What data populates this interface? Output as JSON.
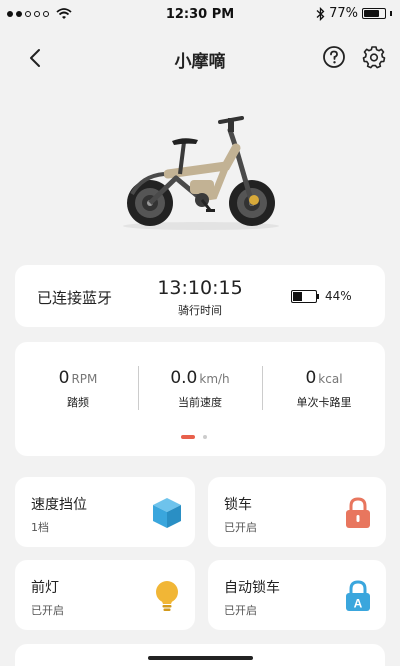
{
  "status_bar": {
    "signal_dots_filled": 2,
    "signal_dots_total": 5,
    "wifi_icon": "wifi-icon",
    "time": "12:30 PM",
    "bluetooth_icon": "bluetooth-icon",
    "battery_percent": "77%",
    "battery_level": 0.77
  },
  "nav": {
    "title": "小摩嘀",
    "back_icon": "chevron-left-icon",
    "help_icon": "question-circle-icon",
    "settings_icon": "gear-icon"
  },
  "status_card": {
    "connection": "已连接蓝牙",
    "ride_time": "13:10:15",
    "ride_time_label": "骑行时间",
    "battery_percent": "44%",
    "battery_level": 0.44
  },
  "metrics": [
    {
      "value": "0",
      "unit": "RPM",
      "label": "踏频"
    },
    {
      "value": "0.0",
      "unit": "km/h",
      "label": "当前速度"
    },
    {
      "value": "0",
      "unit": "kcal",
      "label": "单次卡路里"
    }
  ],
  "pager": {
    "active_index": 0,
    "count": 2
  },
  "tiles": [
    {
      "title": "速度挡位",
      "status": "1档",
      "icon": "cube-icon",
      "color": "#3aa6dd"
    },
    {
      "title": "锁车",
      "status": "已开启",
      "icon": "padlock-icon",
      "color": "#e8765e"
    },
    {
      "title": "前灯",
      "status": "已开启",
      "icon": "lightbulb-icon",
      "color": "#f1b636"
    },
    {
      "title": "自动锁车",
      "status": "已开启",
      "icon": "auto-lock-icon",
      "color": "#3aa6dd",
      "badge": "A"
    }
  ],
  "colors": {
    "accent": "#e8604c",
    "background": "#f2f2f2"
  }
}
